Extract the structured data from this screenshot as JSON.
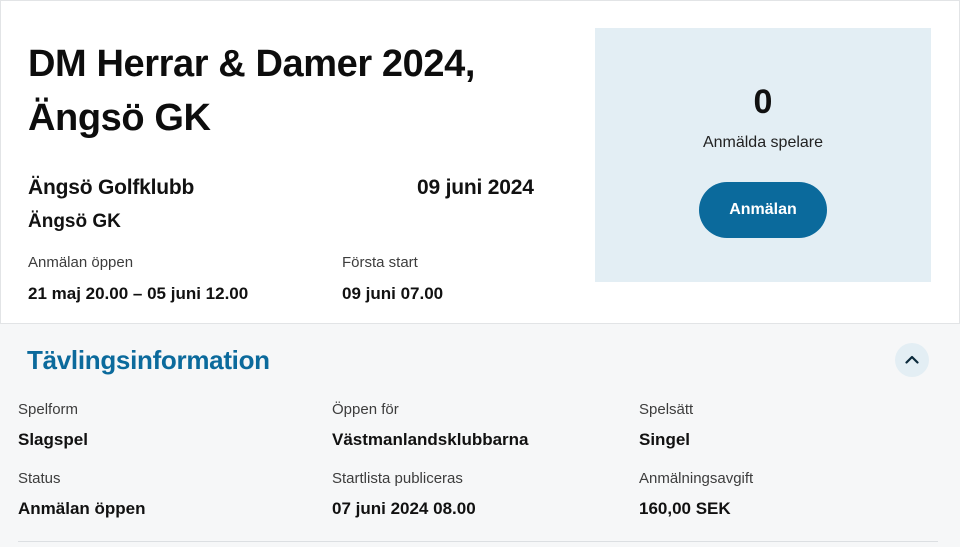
{
  "event": {
    "title": "DM Herrar & Damer 2024, Ängsö GK",
    "club_name": "Ängsö Golfklubb",
    "club_short": "Ängsö GK",
    "date": "09 juni 2024",
    "registration_open_label": "Anmälan öppen",
    "registration_open_value": "21 maj 20.00 – 05 juni 12.00",
    "first_start_label": "Första start",
    "first_start_value": "09 juni 07.00"
  },
  "registration": {
    "count": "0",
    "count_label": "Anmälda spelare",
    "button_label": "Anmälan"
  },
  "competition_info": {
    "title": "Tävlingsinformation",
    "collapse_icon": "chevron-up-icon",
    "fields": [
      {
        "label": "Spelform",
        "value": "Slagspel"
      },
      {
        "label": "Öppen för",
        "value": "Västmanlandsklubbarna"
      },
      {
        "label": "Spelsätt",
        "value": "Singel"
      },
      {
        "label": "Status",
        "value": "Anmälan öppen"
      },
      {
        "label": "Startlista publiceras",
        "value": "07 juni 2024 08.00"
      },
      {
        "label": "Anmälningsavgift",
        "value": "160,00 SEK"
      }
    ]
  },
  "colors": {
    "accent": "#0b6a9c",
    "panel_bg": "#e3eef4"
  }
}
